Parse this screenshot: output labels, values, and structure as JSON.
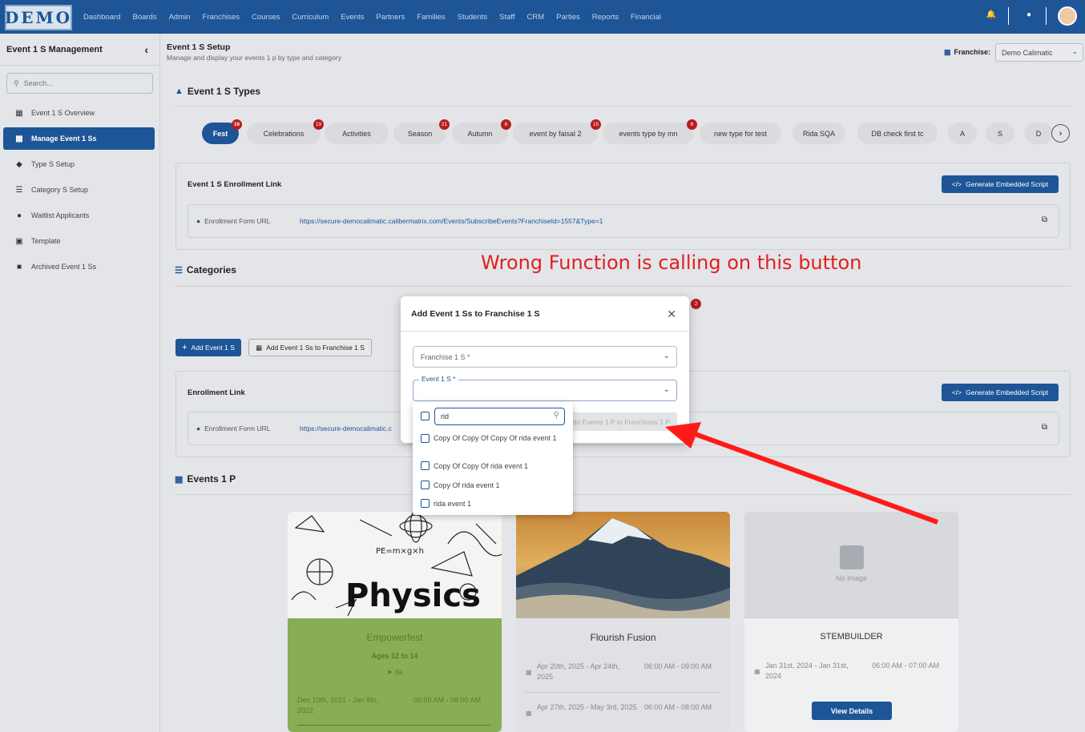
{
  "brand": {
    "logo_text": "DEMO"
  },
  "nav": {
    "items": [
      "Dashboard",
      "Boards",
      "Admin",
      "Franchises",
      "Courses",
      "Curriculum",
      "Events",
      "Partners",
      "Families",
      "Students",
      "Staff",
      "CRM",
      "Parties",
      "Reports",
      "Financial"
    ]
  },
  "topbar": {
    "icons": [
      "bell-icon",
      "help-icon",
      "user-avatar"
    ]
  },
  "sidebar": {
    "title": "Event 1 S Management",
    "search_placeholder": "Search...",
    "items": [
      {
        "label": "Event 1 S Overview",
        "icon": "calendar-icon"
      },
      {
        "label": "Manage Event 1 Ss",
        "icon": "calendar-check-icon",
        "active": true
      },
      {
        "label": "Type S Setup",
        "icon": "tags-icon"
      },
      {
        "label": "Category S Setup",
        "icon": "layers-icon"
      },
      {
        "label": "Waitlist Applicants",
        "icon": "users-clock-icon"
      },
      {
        "label": "Template",
        "icon": "file-icon"
      },
      {
        "label": "Archived Event 1 Ss",
        "icon": "archive-icon"
      }
    ]
  },
  "header": {
    "title": "Event 1 S Setup",
    "subtitle": "Manage and display your events 1 p by type and category",
    "franchise_label": "Franchise:",
    "franchise_value": "Demo Calimatic"
  },
  "types_section": {
    "title": "Event 1 S Types",
    "pills": [
      {
        "label": "Fest",
        "badge": "16",
        "active": true
      },
      {
        "label": "Celebrations",
        "badge": "19"
      },
      {
        "label": "Activities",
        "badge": ""
      },
      {
        "label": "Season",
        "badge": "21"
      },
      {
        "label": "Autumn",
        "badge": "6"
      },
      {
        "label": "event by faisal 2",
        "badge": "15"
      },
      {
        "label": "events type by mn",
        "badge": "6"
      },
      {
        "label": "new type for test",
        "badge": ""
      },
      {
        "label": "Rida SQA",
        "badge": ""
      },
      {
        "label": "DB check first tc",
        "badge": ""
      },
      {
        "label": "A",
        "badge": ""
      },
      {
        "label": "S",
        "badge": ""
      },
      {
        "label": "D",
        "badge": ""
      }
    ]
  },
  "enroll_card_1": {
    "title": "Event 1 S Enrollment Link",
    "generate_label": "Generate Embedded Script",
    "url_label": "Enrollment Form URL",
    "url_value": "https://secure-democalimatic.calibermatrix.com/Events/SubscribeEvents?FranchiseId=1557&Type=1"
  },
  "categories_section": {
    "title": "Categories",
    "badge": "2",
    "add_button": "Add Event 1 S",
    "add_to_franchise_button": "Add Event 1 Ss to Franchise 1 S"
  },
  "enroll_card_2": {
    "title": "Enrollment Link",
    "generate_label": "Generate Embedded Script",
    "url_label": "Enrollment Form URL",
    "url_value": "https://secure-democalimatic.c"
  },
  "events_section": {
    "title": "Events 1 P",
    "cards": [
      {
        "name": "Empowerfest",
        "ages": "Ages 12 to 14",
        "location": "da",
        "dates": "Dec 10th, 2021 - Jan 8th, 2022",
        "time": "06:00 AM - 08:00 AM"
      },
      {
        "name": "Flourish Fusion",
        "rows": [
          {
            "dates": "Apr 20th, 2025 - Apr 24th, 2025",
            "time": "06:00 AM - 09:00 AM"
          },
          {
            "dates": "Apr 27th, 2025 - May 3rd, 2025",
            "time": "06:00 AM - 08:00 AM"
          }
        ]
      },
      {
        "name": "STEMBUILDER",
        "no_image": "No Image",
        "dates": "Jan 31st, 2024 - Jan 31st, 2024",
        "time": "06:00 AM - 07:00 AM",
        "button": "View Details"
      }
    ],
    "physics_text": "Physics",
    "physics_formula": "PE=m×g×h"
  },
  "modal": {
    "title": "Add Event 1 Ss to Franchise 1 S",
    "franchise_placeholder": "Franchise 1 S *",
    "event_label": "Event 1 S *",
    "submit_label": "Add Events 1 P to Franchises 1 P",
    "dropdown": {
      "search_value": "rid",
      "options": [
        "Copy Of Copy Of Copy Of rida event 1",
        "Copy Of Copy Of rida event 1",
        "Copy Of rida event 1",
        "rida event 1"
      ]
    }
  },
  "annotation": {
    "text": "Wrong Function is calling on this button",
    "color": "#e0201f"
  }
}
